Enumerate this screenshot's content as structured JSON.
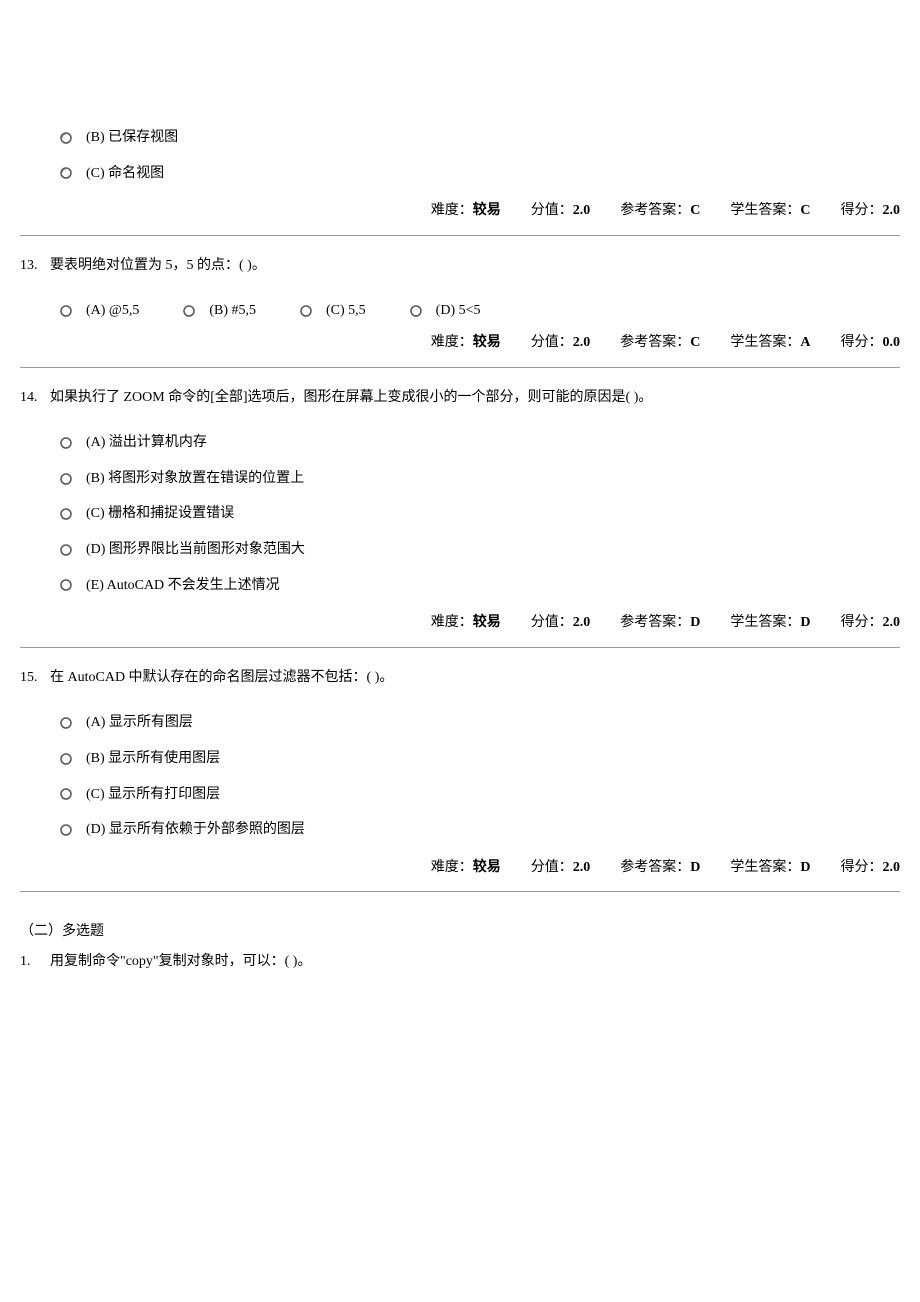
{
  "meta_labels": {
    "difficulty_label": "难度：",
    "score_label": "分值：",
    "ref_label": "参考答案：",
    "stu_label": "学生答案：",
    "got_label": "得分："
  },
  "q12": {
    "options": {
      "b": "(B) 已保存视图",
      "c": "(C) 命名视图"
    },
    "difficulty": "较易",
    "score": "2.0",
    "ref_answer": "C",
    "stu_answer": "C",
    "got": "2.0"
  },
  "q13": {
    "num": "13.",
    "stem": "要表明绝对位置为 5，5 的点：( )。",
    "options": {
      "a": "(A) @5,5",
      "b": "(B) #5,5",
      "c": "(C) 5,5",
      "d": "(D) 5<5"
    },
    "difficulty": "较易",
    "score": "2.0",
    "ref_answer": "C",
    "stu_answer": "A",
    "got": "0.0"
  },
  "q14": {
    "num": "14.",
    "stem": "如果执行了 ZOOM 命令的[全部]选项后，图形在屏幕上变成很小的一个部分，则可能的原因是( )。",
    "options": {
      "a": "(A) 溢出计算机内存",
      "b": "(B) 将图形对象放置在错误的位置上",
      "c": "(C) 栅格和捕捉设置错误",
      "d": "(D) 图形界限比当前图形对象范围大",
      "e": "(E) AutoCAD 不会发生上述情况"
    },
    "difficulty": "较易",
    "score": "2.0",
    "ref_answer": "D",
    "stu_answer": "D",
    "got": "2.0"
  },
  "q15": {
    "num": "15.",
    "stem": "在 AutoCAD 中默认存在的命名图层过滤器不包括：( )。",
    "options": {
      "a": "(A) 显示所有图层",
      "b": "(B) 显示所有使用图层",
      "c": "(C) 显示所有打印图层",
      "d": "(D) 显示所有依赖于外部参照的图层"
    },
    "difficulty": "较易",
    "score": "2.0",
    "ref_answer": "D",
    "stu_answer": "D",
    "got": "2.0"
  },
  "section2": {
    "heading": "（二）多选题",
    "q1": {
      "num": "1.",
      "stem": "用复制命令\"copy\"复制对象时，可以：( )。"
    }
  }
}
